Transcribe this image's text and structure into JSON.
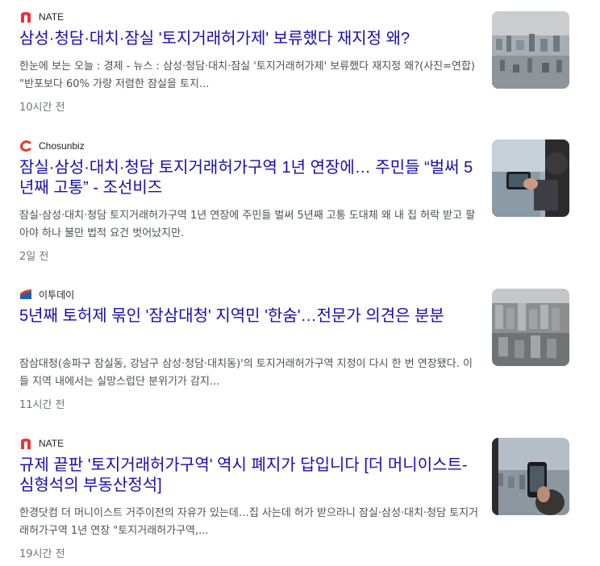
{
  "articles": [
    {
      "source": "NATE",
      "source_icon": "nate-logo-icon",
      "headline": "삼성·청담·대치·잠실 '토지거래허가제' 보류했다 재지정 왜?",
      "snippet": "한눈에 보는 오늘 : 경제 - 뉴스 : 삼성·청담·대치·잠실 '토지거래허가제' 보류했다 재지정 왜?(사진=연합) \"반포보다 60% 가량 저렴한 잠실을 토지...",
      "time": "10시간 전",
      "thumbnail": "city-aerial-thumbnail"
    },
    {
      "source": "Chosunbiz",
      "source_icon": "chosunbiz-logo-icon",
      "headline": "잠실·삼성·대치·청담 토지거래허가구역 1년 연장에… 주민들 “벌써 5년째 고통” - 조선비즈",
      "snippet": "잠실·삼성·대치·청담 토지거래허가구역 1년 연장에 주민들 벌써 5년째 고통 도대체 왜 내 집 허락 받고 팔아야 하나 불만 법적 요건 벗어났지만.",
      "time": "2일 전",
      "thumbnail": "phone-photo-thumbnail"
    },
    {
      "source": "이투데이",
      "source_icon": "etoday-logo-icon",
      "headline": "5년째 토허제 묶인 '잠삼대청' 지역민 '한숨'…전문가 의견은 분분",
      "snippet": "잠삼대청(송파구 잠실동, 강남구 삼성·청담·대치동)'의 토지거래허가구역 지정이 다시 한 번 연장됐다. 이들 지역 내에서는 실망스럽단 분위기가 감지...",
      "time": "11시간 전",
      "thumbnail": "apartments-aerial-thumbnail"
    },
    {
      "source": "NATE",
      "source_icon": "nate-logo-icon",
      "headline": "규제 끝판 '토지거래허가구역' 역시 폐지가 답입니다 [더 머니이스트-심형석의 부동산정석]",
      "snippet": "한경닷컴 더 머니이스트 거주이전의 자유가 있는데…집 사는데 허가 받으라니 잠실·삼성·대치·청담 토지거래허가구역 1년 연장 \"토지거래허가구역,...",
      "time": "19시간 전",
      "thumbnail": "window-phone-thumbnail"
    }
  ],
  "colors": {
    "headline": "#1a0dab",
    "snippet": "#4d5156",
    "time": "#70757a",
    "nate": "#e8343a",
    "chosunbiz": "#e23b2e",
    "etoday": "#1f5fa8"
  }
}
